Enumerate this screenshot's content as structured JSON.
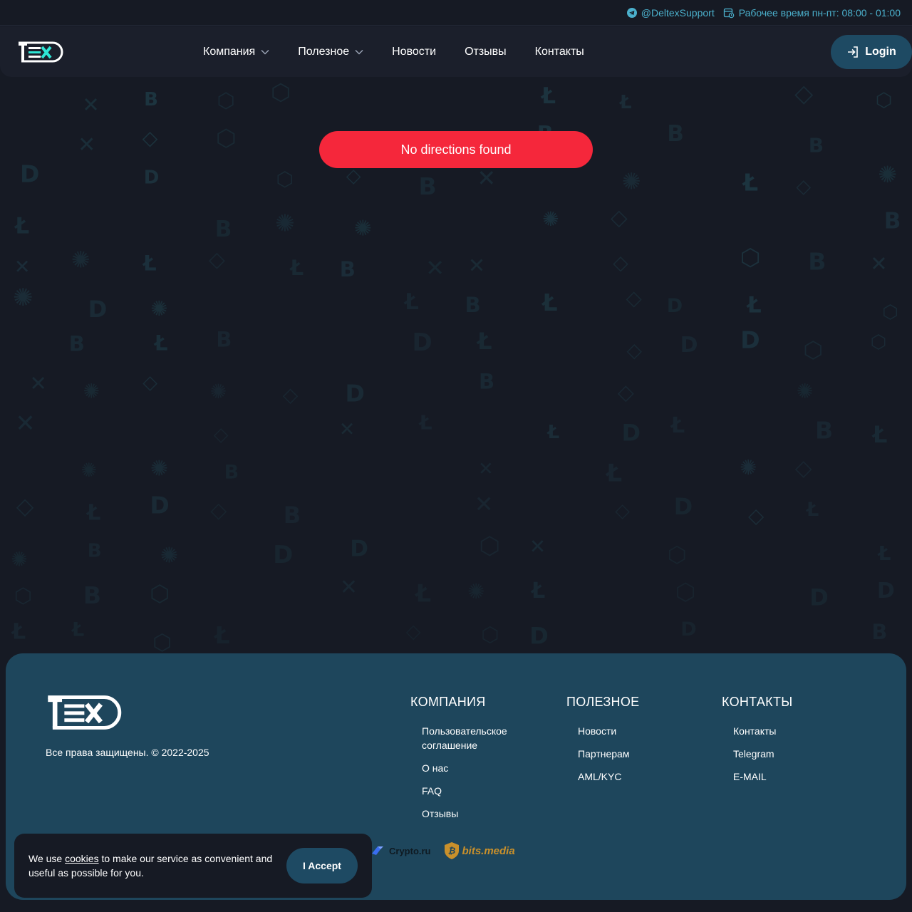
{
  "topbar": {
    "telegram": "@DeltexSupport",
    "hours": "Рабочее время пн-пт: 08:00 - 01:00"
  },
  "header": {
    "nav": [
      {
        "label": "Компания",
        "dropdown": true
      },
      {
        "label": "Полезное",
        "dropdown": true
      },
      {
        "label": "Новости",
        "dropdown": false
      },
      {
        "label": "Отзывы",
        "dropdown": false
      },
      {
        "label": "Контакты",
        "dropdown": false
      }
    ],
    "login_label": "Login"
  },
  "alert": {
    "message": "No directions found",
    "color": "#f5273b"
  },
  "footer": {
    "copyright": "Все права защищены. © 2022-2025",
    "columns": [
      {
        "title": "КОМПАНИЯ",
        "links": [
          "Пользовательское соглашение",
          "О нас",
          "FAQ",
          "Отзывы"
        ]
      },
      {
        "title": "ПОЛЕЗНОЕ",
        "links": [
          "Новости",
          "Партнерам",
          "AML/KYC"
        ]
      },
      {
        "title": "КОНТАКТЫ",
        "links": [
          "Контакты",
          "Telegram",
          "E-MAIL"
        ]
      }
    ],
    "partners": [
      "Crypto.ru",
      "bits.media"
    ]
  },
  "cookie": {
    "text_before": "We use ",
    "link": "cookies",
    "text_after": " to make our service as convenient and useful as possible for you.",
    "accept_label": "I Accept"
  },
  "colors": {
    "background": "#161a24",
    "accent": "#1e4a63",
    "footer": "#1e465c",
    "link": "#4bb0cc"
  }
}
